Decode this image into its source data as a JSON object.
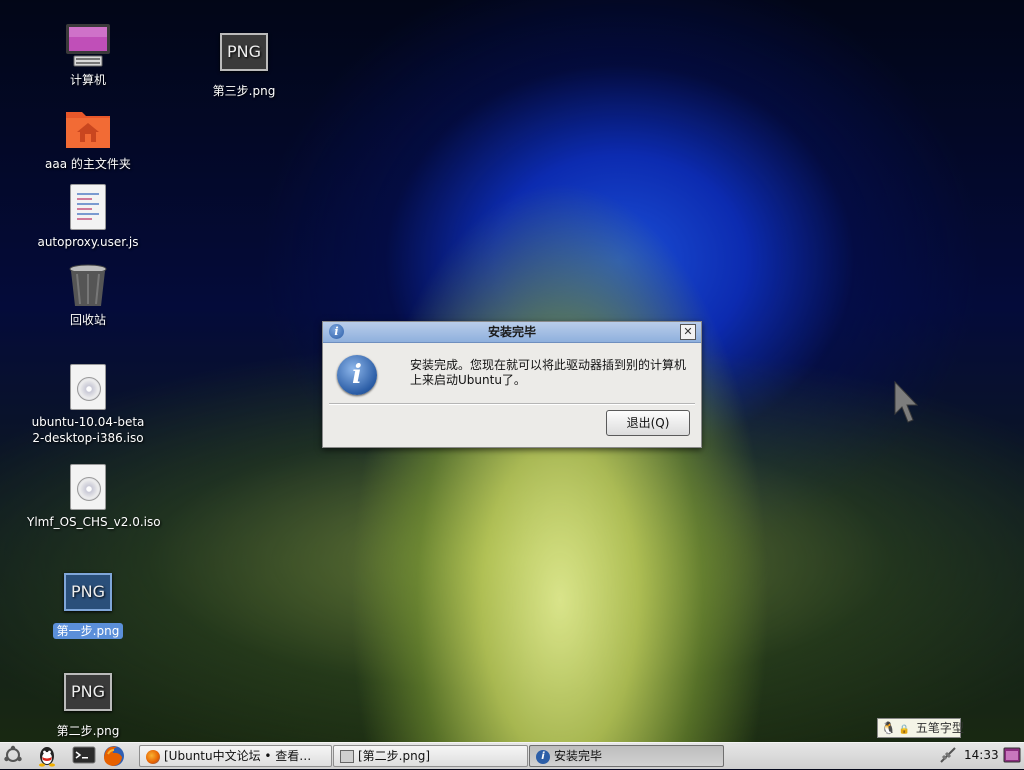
{
  "desktop": {
    "icons": [
      {
        "name": "computer",
        "label": "计算机"
      },
      {
        "name": "home-folder",
        "label": "aaa 的主文件夹"
      },
      {
        "name": "autoproxy",
        "label": "autoproxy.user.js"
      },
      {
        "name": "trash",
        "label": "回收站"
      },
      {
        "name": "ubuntu-iso",
        "label": "ubuntu-10.04-beta2-desktop-i386.iso"
      },
      {
        "name": "ylmf-iso",
        "label": "Ylmf_OS_CHS_v2.0.iso"
      },
      {
        "name": "step1",
        "label": "第一步.png",
        "glyph": "PNG",
        "selected": true
      },
      {
        "name": "step2",
        "label": "第二步.png",
        "glyph": "PNG"
      },
      {
        "name": "step3",
        "label": "第三步.png",
        "glyph": "PNG"
      }
    ]
  },
  "dialog": {
    "title": "安装完毕",
    "message": "安装完成。您现在就可以将此驱动器插到别的计算机上来启动Ubuntu了。",
    "quit_label": "退出(Q)",
    "close_glyph": "✕",
    "info_glyph": "i"
  },
  "taskbar": {
    "tasks": [
      {
        "label": "[Ubuntu中文论坛 • 查看…",
        "icon": "firefox-icon"
      },
      {
        "label": "[第二步.png]",
        "icon": "image-viewer-icon"
      },
      {
        "label": "安装完毕",
        "icon": "info-icon",
        "active": true
      }
    ],
    "clock": "14:33"
  },
  "ime": {
    "label": "五笔字型"
  },
  "colors": {
    "accent": "#5b8fd9",
    "titlebar": "#9ab6e0"
  }
}
